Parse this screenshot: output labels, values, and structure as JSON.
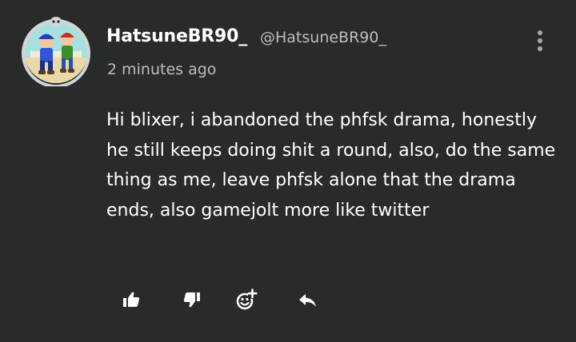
{
  "comment": {
    "author": {
      "display_name": "HatsuneBR90_",
      "handle": "@HatsuneBR90_",
      "avatar_icon": "mario-luigi-avatar"
    },
    "timestamp": "2 minutes ago",
    "text": "Hi blixer, i abandoned the phfsk drama, honestly he still keeps doing shit a round, also, do the same thing as me, leave phfsk alone that the drama ends, also gamejolt more like twitter",
    "actions": {
      "like_icon": "thumbs-up-icon",
      "dislike_icon": "thumbs-down-icon",
      "add_reaction_icon": "emoji-add-icon",
      "reply_icon": "reply-icon"
    },
    "more_icon": "more-vertical-icon"
  },
  "colors": {
    "background": "#292b2a",
    "text": "#ffffff",
    "muted_text": "#bdbdbd",
    "avatar_ring": "#d5d5d5"
  }
}
